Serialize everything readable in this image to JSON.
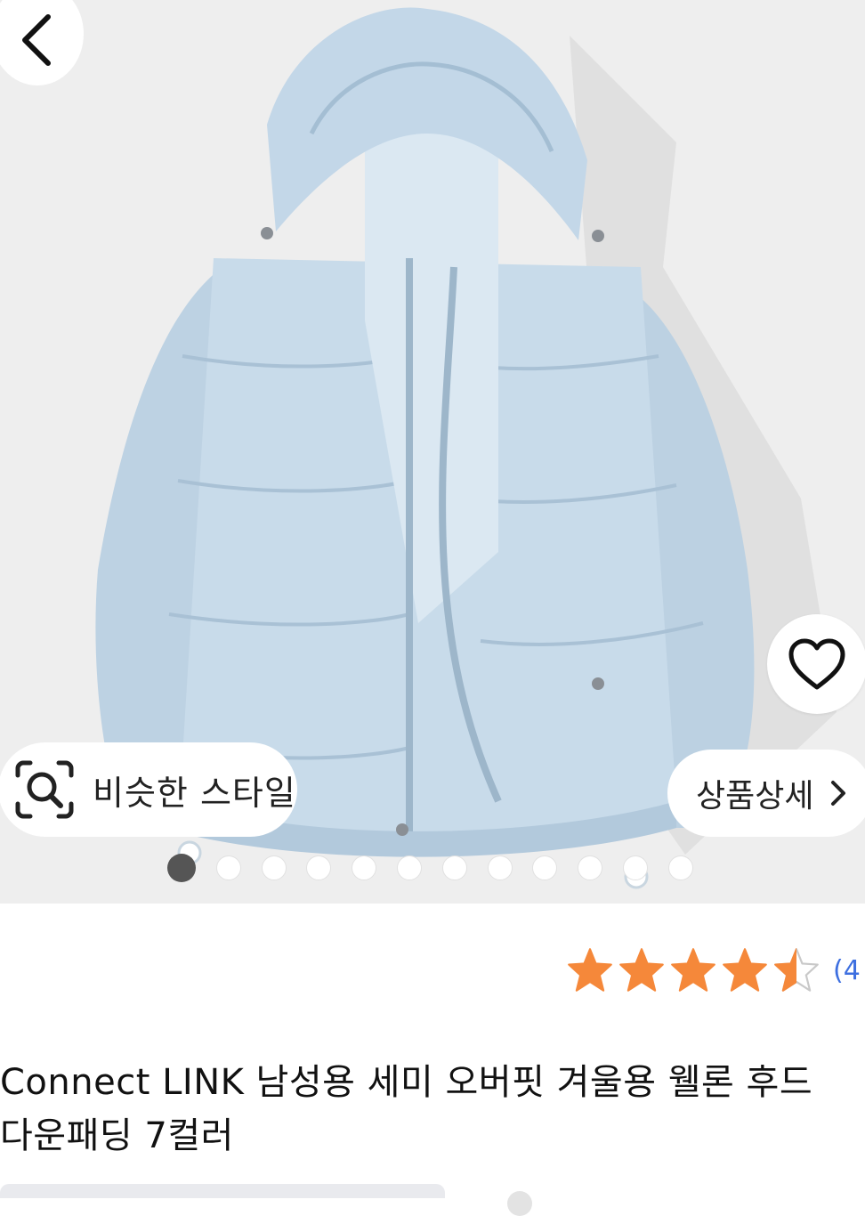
{
  "product": {
    "title_line1": "Connect LINK 남성용 세미 오버핏 겨울용 웰론 후드",
    "title_line2": "다운패딩 7컬러"
  },
  "buttons": {
    "similar_style": "비슷한 스타일",
    "product_detail": "상품상세"
  },
  "rating": {
    "value": 4.5,
    "max": 5,
    "count_text": "(4",
    "star_color": "#f5883a",
    "count_color": "#3d6fe0"
  },
  "carousel": {
    "total_images": 12,
    "current_index": 1
  },
  "colors": {
    "jacket": "#c4d8e8",
    "jacket_shadow": "#9fb9cf",
    "background": "#eeeeee"
  },
  "icons": [
    "back-arrow-icon",
    "heart-icon",
    "image-search-icon",
    "chevron-right-icon",
    "star-icon"
  ]
}
